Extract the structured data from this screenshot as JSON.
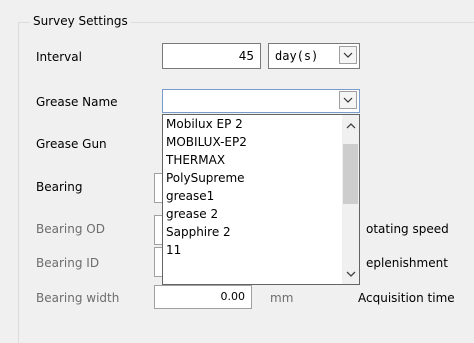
{
  "group": {
    "title": "Survey Settings"
  },
  "labels": {
    "interval": "Interval",
    "grease_name": "Grease Name",
    "grease_gun": "Grease Gun",
    "bearing": "Bearing",
    "bearing_od": "Bearing OD",
    "bearing_id": "Bearing ID",
    "bearing_width": "Bearing width"
  },
  "interval": {
    "value": "45",
    "unit": "day(s)"
  },
  "grease_name": {
    "value": "",
    "options": [
      "Mobilux EP 2",
      "MOBILUX-EP2",
      "THERMAX",
      "PolySupreme",
      "grease1",
      "grease 2",
      "Sapphire 2",
      "11"
    ]
  },
  "bearing_width": {
    "value": "0.00",
    "unit": "mm"
  },
  "right_labels": {
    "rotating_speed": "otating speed",
    "replenishment": "eplenishment",
    "acquisition_time": "Acquisition time"
  },
  "icons": {
    "chevron_down": "chevron-down-icon",
    "scroll_up": "scroll-up-arrow-icon",
    "scroll_down": "scroll-down-arrow-icon"
  }
}
